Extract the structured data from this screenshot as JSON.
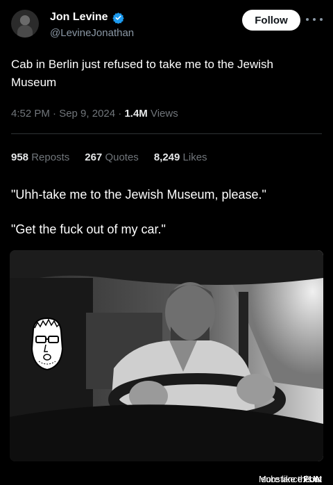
{
  "tweet": {
    "name": "Jon Levine",
    "handle": "@LevineJonathan",
    "follow_label": "Follow",
    "text": "Cab in Berlin just refused to take me to the Jewish Museum",
    "time": "4:52 PM · Sep 9, 2024 · ",
    "views_count": "1.4M",
    "views_label": " Views",
    "stats": [
      {
        "count": "958",
        "label": "Reposts"
      },
      {
        "count": "267",
        "label": "Quotes"
      },
      {
        "count": "8,249",
        "label": "Likes"
      }
    ]
  },
  "meme": {
    "line1": "\"Uhh-take me to the Jewish Museum, please.\"",
    "line2": "\"Get the fuck out of my car.\""
  },
  "footer": {
    "prefix": "More like this at ",
    "brand_bold": "FUN",
    "brand_rest": "substance.com"
  },
  "colors": {
    "verified": "#1d9bf0",
    "muted": "#71767b",
    "handle": "#8b98a5"
  }
}
